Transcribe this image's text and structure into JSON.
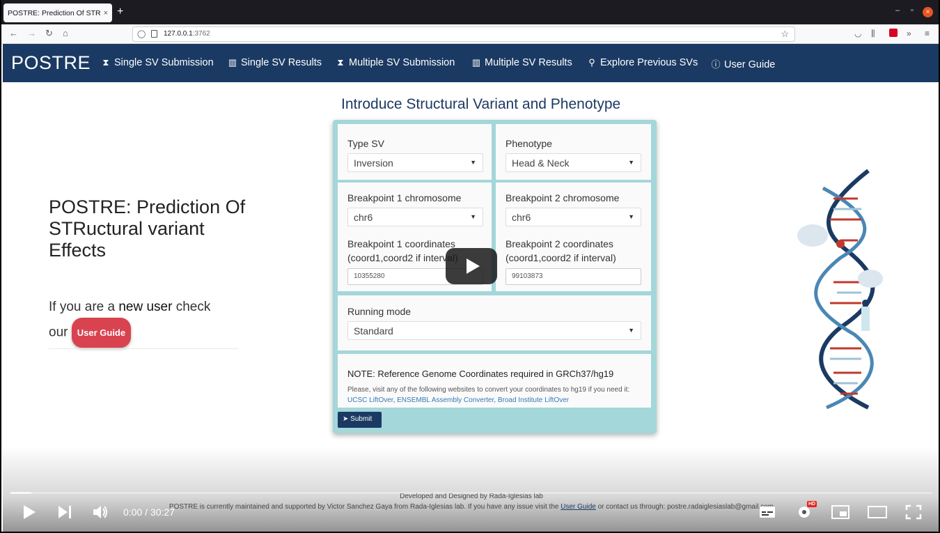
{
  "browser": {
    "tab_title": "POSTRE: Prediction Of STRu",
    "tab_close": "×",
    "new_tab": "+",
    "url_host": "127.0.0.1",
    "url_port": ":3762",
    "win_min": "–",
    "win_max": "▫",
    "win_close": "×"
  },
  "app": {
    "brand": "POSTRE",
    "nav": [
      {
        "label": "Single SV Submission",
        "icon": "hourglass-icon"
      },
      {
        "label": "Single SV Results",
        "icon": "bar-chart-icon"
      },
      {
        "label": "Multiple SV Submission",
        "icon": "hourglass-icon"
      },
      {
        "label": "Multiple SV Results",
        "icon": "bar-chart-icon"
      },
      {
        "label": "Explore Previous SVs",
        "icon": "search-icon"
      },
      {
        "label": "User Guide",
        "icon": "info-icon"
      }
    ]
  },
  "hero": {
    "title": "POSTRE: Prediction Of STRuctural variant Effects",
    "sub_prefix": "If you are a ",
    "sub_bold": "new user",
    "sub_mid": " check",
    "sub_our": "our ",
    "user_guide_button": "User Guide"
  },
  "form": {
    "title": "Introduce Structural Variant and Phenotype",
    "type_sv_label": "Type SV",
    "type_sv_value": "Inversion",
    "phenotype_label": "Phenotype",
    "phenotype_value": "Head & Neck",
    "bp1_chr_label": "Breakpoint 1 chromosome",
    "bp1_chr_value": "chr6",
    "bp2_chr_label": "Breakpoint 2 chromosome",
    "bp2_chr_value": "chr6",
    "bp1_coord_label_1": "Breakpoint 1 coordinates",
    "bp1_coord_label_2": "(coord1,coord2 if interval)",
    "bp1_coord_value": "10355280",
    "bp2_coord_label_1": "Breakpoint 2 coordinates",
    "bp2_coord_label_2": "(coord1,coord2 if interval)",
    "bp2_coord_value": "99103873",
    "mode_label": "Running mode",
    "mode_value": "Standard",
    "note_title": "NOTE: Reference Genome Coordinates required in GRCh37/hg19",
    "note_text_1": "Please, visit any of the following websites to convert your coordinates to hg19 if you need it: ",
    "link_ucsc": "UCSC LiftOver",
    "link_ensembl": "ENSEMBL Assembly Converter",
    "link_broad": "Broad Institute LiftOver",
    "sep": ", ",
    "submit": "Submit"
  },
  "footer": {
    "line1": "Developed and Designed by Rada-Iglesias lab",
    "line2_a": "POSTRE is currently maintained and supported by Victor Sanchez Gaya from Rada-Iglesias lab. If you have any issue visit the ",
    "line2_link": "User Guide",
    "line2_b": " or contact us through: postre.radaiglesiaslab@gmail.com"
  },
  "video": {
    "time": "0:00 / 30:27",
    "hd_badge": "HD",
    "progress_fraction": 0.0
  },
  "colors": {
    "navbar": "#1b3a63",
    "form_bg": "#a3d7d9",
    "button_red": "#d8434f",
    "link": "#337ab7"
  }
}
